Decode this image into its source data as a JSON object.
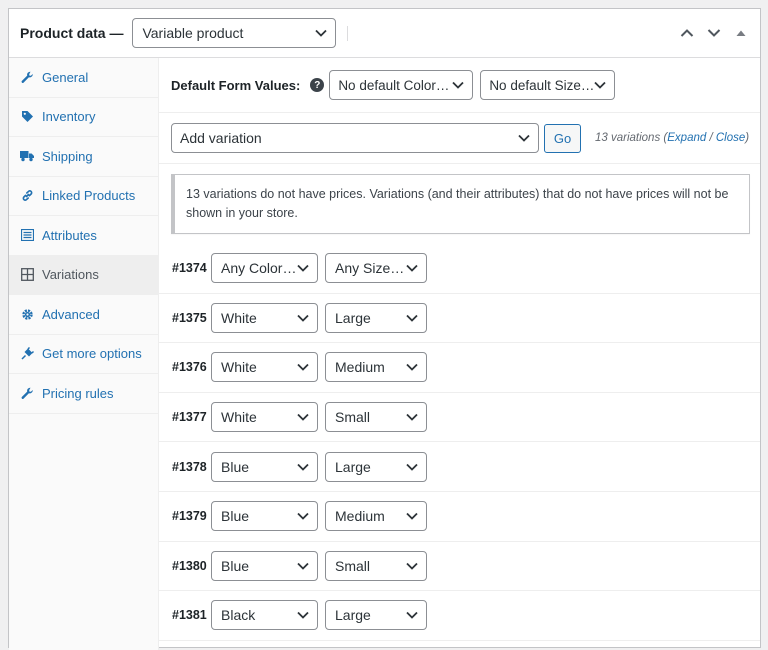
{
  "header": {
    "title": "Product data —",
    "product_type": "Variable product",
    "icons": [
      "chevron-up-icon",
      "chevron-down-icon",
      "toggle-arrow-icon"
    ]
  },
  "tabs": [
    {
      "label": "General",
      "icon": "wrench-icon"
    },
    {
      "label": "Inventory",
      "icon": "tag-icon"
    },
    {
      "label": "Shipping",
      "icon": "truck-icon"
    },
    {
      "label": "Linked Products",
      "icon": "link-icon"
    },
    {
      "label": "Attributes",
      "icon": "list-icon"
    },
    {
      "label": "Variations",
      "icon": "grid-icon",
      "active": true
    },
    {
      "label": "Advanced",
      "icon": "gear-icon"
    },
    {
      "label": "Get more options",
      "icon": "plugin-icon"
    },
    {
      "label": "Pricing rules",
      "icon": "wrench-icon"
    }
  ],
  "defaults": {
    "label": "Default Form Values:",
    "color_select": "No default Color…",
    "size_select": "No default Size…"
  },
  "add": {
    "select": "Add variation",
    "go_label": "Go",
    "count_text": "13 variations",
    "expand_label": "Expand",
    "separator": "/",
    "close_label": "Close"
  },
  "notice": {
    "text": "13 variations do not have prices. Variations (and their attributes) that do not have prices will not be shown in your store."
  },
  "variations": [
    {
      "id": "#1374",
      "color": "Any Color…",
      "size": "Any Size…"
    },
    {
      "id": "#1375",
      "color": "White",
      "size": "Large"
    },
    {
      "id": "#1376",
      "color": "White",
      "size": "Medium"
    },
    {
      "id": "#1377",
      "color": "White",
      "size": "Small"
    },
    {
      "id": "#1378",
      "color": "Blue",
      "size": "Large"
    },
    {
      "id": "#1379",
      "color": "Blue",
      "size": "Medium"
    },
    {
      "id": "#1380",
      "color": "Blue",
      "size": "Small"
    },
    {
      "id": "#1381",
      "color": "Black",
      "size": "Large"
    }
  ],
  "colors": {
    "link": "#2271b1",
    "text": "#1d2327",
    "border": "#c3c4c7"
  }
}
